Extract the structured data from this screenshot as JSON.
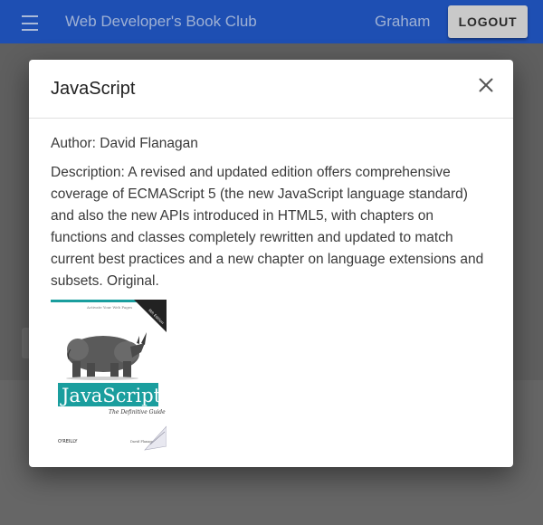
{
  "appbar": {
    "title": "Web Developer's Book Club",
    "username": "Graham",
    "logout_label": "LOGOUT",
    "menu_icon": "menu-icon"
  },
  "modal": {
    "title": "JavaScript",
    "close_icon": "close-icon",
    "author": "Author: David Flanagan",
    "description": "Description: A revised and updated edition offers comprehensive coverage of ECMAScript 5 (the new JavaScript language standard) and also the new APIs introduced in HTML5, with chapters on functions and classes completely rewritten and updated to match current best practices and a new chapter on language extensions and subsets. Original.",
    "cover": {
      "tagline": "Activate Your Web Pages",
      "edition": "6th Edition",
      "title": "JavaScript",
      "subtitle": "The Definitive Guide",
      "publisher": "O'REILLY",
      "author_short": "David Flanagan"
    }
  },
  "colors": {
    "appbar": "#1e4fb3",
    "overlay": "#5f5f5f",
    "cover_teal": "#1a9e9e"
  }
}
